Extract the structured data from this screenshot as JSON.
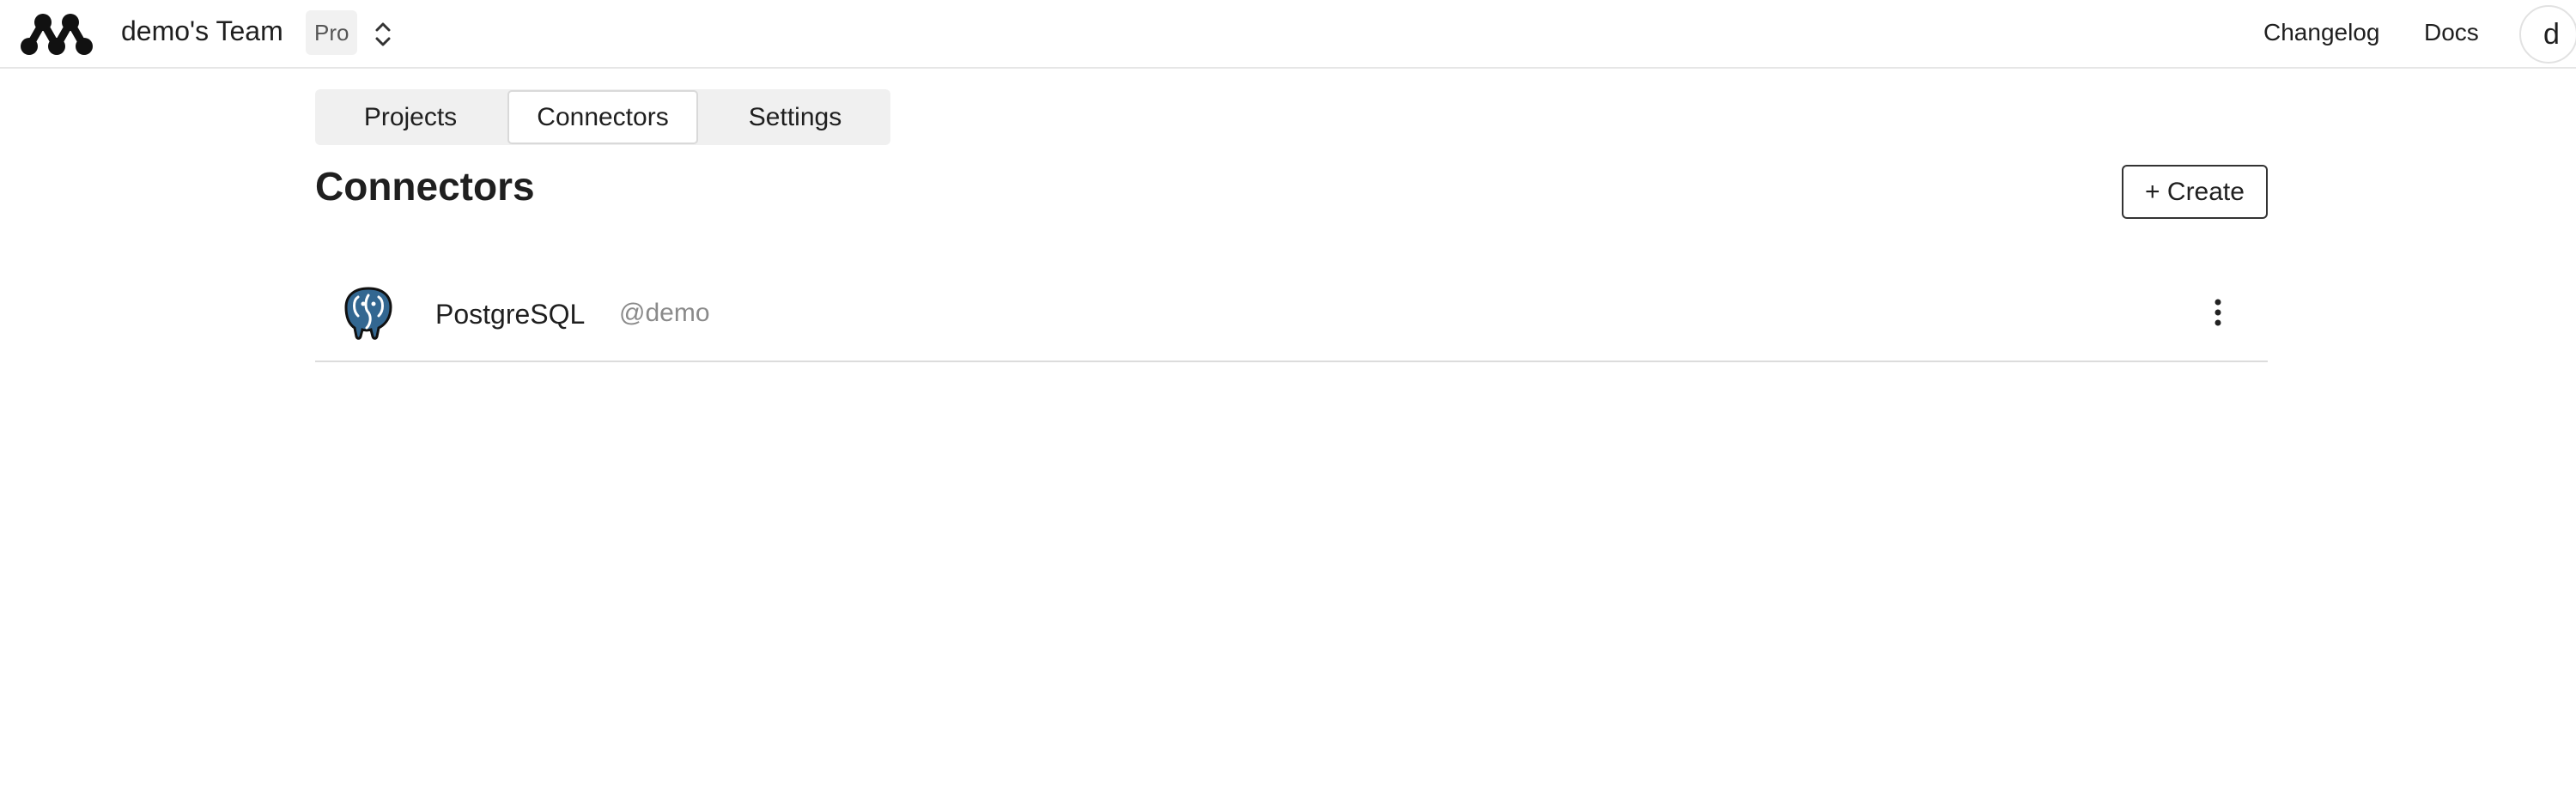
{
  "header": {
    "team_name": "demo's Team",
    "plan": "Pro",
    "nav": {
      "changelog": "Changelog",
      "docs": "Docs"
    },
    "avatar_initial": "d"
  },
  "tabs": [
    {
      "label": "Projects",
      "active": false
    },
    {
      "label": "Connectors",
      "active": true
    },
    {
      "label": "Settings",
      "active": false
    }
  ],
  "page": {
    "title": "Connectors",
    "create_label": "+ Create"
  },
  "connectors": [
    {
      "name": "PostgreSQL",
      "owner": "@demo",
      "icon": "postgresql-elephant-icon"
    }
  ],
  "colors": {
    "postgres_blue": "#336791",
    "tab_bg": "#f0f0f0",
    "muted_text": "#8a8a8a"
  }
}
